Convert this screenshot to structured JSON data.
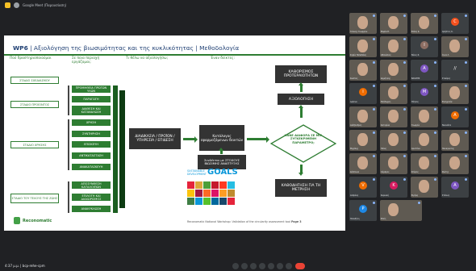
{
  "window": {
    "title": "Google Meet (Παρουσίαση)"
  },
  "slide": {
    "title_prefix": "WP6",
    "title_rest": " | Αξιολόγηση της βιωσιμότητας και της κυκλικότητας | Μεθοδολογία",
    "col_headers": [
      "Πού δραστηριοποιούμαι",
      "Σε ποια περιοχή εργάζομαι;",
      "Τι θέλω να αξιολογήσω;",
      "Έναν δείκτες:"
    ],
    "stages": [
      "ΣΤΑΔΙΟ ΣΧΕΔΙΑΣΜΟΥ",
      "ΣΤΑΔΙΟ ΠΡΟΪΟΝΤΟΣ",
      "ΣΤΑΔΙΟ ΧΡΗΣΗΣ",
      "ΣΤΑΔΙΟ ΤΟΥ ΤΕΛΟΥΣ ΤΗΣ ΖΩΗΣ"
    ],
    "areas": [
      "ΠΡΟΜΗΘΕΙΑ ΠΡΩΤΩΝ ΥΛΩΝ",
      "ΠΑΡΑΓΩΓΗ",
      "ΔΙΑΘΕΣΗ ΚΑΙ ΚΑΤΑΝΑΛΩΣΗ",
      "ΧΡΗΣΗ",
      "ΣΥΝΤΗΡΗΣΗ",
      "ΕΠΙΣΚΕΥΗ",
      "ΑΝΤΙΚΑΤΑΣΤΑΣΗ",
      "ΑΝΑΚΑΤΑΣΚΕΥΗ",
      "ΑΠΟΣΥΝΘΕΣΗ ΚΑΤΑΛΟΙΠΩΝ",
      "ΕΠΙΛΟΓΗ ΚΑΙ ΔΙΑΧΩΡΙΣΜΟΣ",
      "ΑΝΑΚΥΚΛΩΣΗ"
    ],
    "assess_box": "ΔΙΑΔΙΚΑΣΙΑ / ΠΡΟΪΟΝ / ΥΠΗΡΕΣΙΑ / ΕΠΙΔΕΣΗ",
    "catalog_box": "Κατάλογος εφαρμοζόμενων δεικτών",
    "sdg_box": "Συνδέεται με ΣΤΟΧΟΥΣ ΒΙΩΣΙΜΗΣ ΑΝΑΠΤΥΞΗΣ",
    "sdg_logo_line1": "SUSTAINABLE",
    "sdg_logo_line2": "DEVELOPMENT",
    "sdg_logo_goals": "GOALS",
    "prioritization": "ΚΑΘΟΡΙΣΜΟΣ ΠΡΟΤΕΡΑΙΟΤΗΤΩΝ",
    "evaluation": "ΑΞΙΟΛΟΓΗΣΗ",
    "diamond": "ΚΑΝΕ ΔΙΑΦΟΡΑ ΣΕ ΜΙΑ ΣΥΓΚΕΚΡΙΜΕΝΗ ΠΑΡΑΜΕΤΡΟ;",
    "measure": "ΚΑΘΟΔΗΓΗΣΗ ΓΙΑ ΤΗ ΜΕΤΡΗΣΗ",
    "logo": "Reconomatic",
    "footer": "Reconomatic National Workshop: Validation of the circularity assessment tool",
    "page": "Page 3",
    "sdg_colors": [
      "#e5243b",
      "#dda63a",
      "#4c9f38",
      "#c5192d",
      "#ff3a21",
      "#26bde2",
      "#fcc30b",
      "#a21942",
      "#fd6925",
      "#dd1367",
      "#fd9d24",
      "#bf8b2e",
      "#3f7e44",
      "#0a97d9",
      "#56c02b",
      "#00689d",
      "#19486a",
      "#e5243b"
    ]
  },
  "participants": [
    {
      "name": "Γιάννης Γεωργίου",
      "initial": "",
      "color": "#5f6368",
      "cam": true
    },
    {
      "name": "Μαρία Π.",
      "initial": "",
      "color": "#5f6368",
      "cam": true
    },
    {
      "name": "Ελένη Κ.",
      "initial": "",
      "color": "#5f6368",
      "cam": true
    },
    {
      "name": "Χρήστος Κ.",
      "initial": "C",
      "color": "#f4511e",
      "cam": false
    },
    {
      "name": "Σοφία Παπαδάκη",
      "initial": "",
      "color": "#5f6368",
      "cam": true
    },
    {
      "name": "Αθανάσιος",
      "initial": "",
      "color": "#5f6368",
      "cam": true
    },
    {
      "name": "Νίκος Ζ.",
      "initial": "I",
      "color": "#8d6e63",
      "cam": false
    },
    {
      "name": "Άννα Λ.",
      "initial": "",
      "color": "#5f6368",
      "cam": true
    },
    {
      "name": "Κώστας",
      "initial": "",
      "color": "#5f6368",
      "cam": true
    },
    {
      "name": "Δημήτρης",
      "initial": "",
      "color": "#5f6368",
      "cam": true
    },
    {
      "name": "ΒΑΣΙΛΗΣ",
      "initial": "A",
      "color": "#7e57c2",
      "cam": false
    },
    {
      "name": "Σταύρος",
      "initial": "//",
      "color": "#3c4043",
      "cam": false
    },
    {
      "name": "Ιωάννα",
      "initial": "I",
      "color": "#ef6c00",
      "cam": false
    },
    {
      "name": "Θεόδωρος",
      "initial": "",
      "color": "#5f6368",
      "cam": true
    },
    {
      "name": "Πέτρος",
      "initial": "M",
      "color": "#7e57c2",
      "cam": false
    },
    {
      "name": "Ευαγγελία",
      "initial": "",
      "color": "#5f6368",
      "cam": true
    },
    {
      "name": "Αλέξανδρος",
      "initial": "",
      "color": "#5f6368",
      "cam": true
    },
    {
      "name": "Κατερίνα",
      "initial": "",
      "color": "#5f6368",
      "cam": true
    },
    {
      "name": "Γεωργία",
      "initial": "",
      "color": "#5f6368",
      "cam": true
    },
    {
      "name": "Νικολέτα",
      "initial": "A",
      "color": "#ef6c00",
      "cam": false
    },
    {
      "name": "Μιχάλης",
      "initial": "",
      "color": "#5f6368",
      "cam": true
    },
    {
      "name": "Ηλίας",
      "initial": "",
      "color": "#5f6368",
      "cam": true
    },
    {
      "name": "Χριστίνα",
      "initial": "",
      "color": "#5f6368",
      "cam": true
    },
    {
      "name": "Παναγιώτης",
      "initial": "",
      "color": "#5f6368",
      "cam": true
    },
    {
      "name": "Δέσποινα",
      "initial": "",
      "color": "#5f6368",
      "cam": true
    },
    {
      "name": "Λάμπρος",
      "initial": "",
      "color": "#5f6368",
      "cam": true
    },
    {
      "name": "Σπύρος",
      "initial": "",
      "color": "#5f6368",
      "cam": true
    },
    {
      "name": "Φώτης",
      "initial": "",
      "color": "#5f6368",
      "cam": true
    },
    {
      "name": "Ανδρέας",
      "initial": "V",
      "color": "#ef6c00",
      "cam": false
    },
    {
      "name": "Κυριακή",
      "initial": "K",
      "color": "#d81b60",
      "cam": false
    },
    {
      "name": "Ειρήνη",
      "initial": "",
      "color": "#5f6368",
      "cam": true
    },
    {
      "name": "Στέλιος",
      "initial": "A",
      "color": "#7e57c2",
      "cam": false
    },
    {
      "name": "Ορέστης",
      "initial": "//",
      "color": "#3c4043",
      "cam": false
    },
    {
      "name": "Πολυξένη",
      "initial": "P",
      "color": "#1e88e5",
      "cam": false
    },
    {
      "name": "Εσείς",
      "initial": "",
      "color": "#5f6368",
      "cam": true
    }
  ],
  "bottom": {
    "time": "4:37 μ.μ. | bcp-rehe-cpm"
  }
}
